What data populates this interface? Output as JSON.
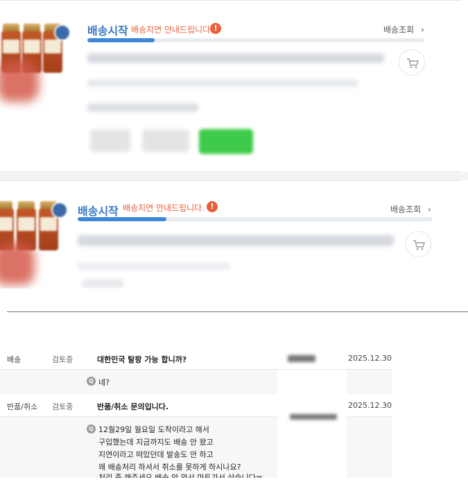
{
  "orders": [
    {
      "status": "배송시작",
      "delay_notice": "배송지연 안내드립니다.",
      "tracking_link": "배송조회",
      "progress": 0.2
    },
    {
      "status": "배송시작",
      "delay_notice": "배송지연 안내드립니다.",
      "tracking_link": "배송조회",
      "progress": 0.25
    }
  ],
  "icons": {
    "alert": "!",
    "chevron": "›",
    "question": "Q"
  },
  "colors": {
    "status_blue": "#3a78c4",
    "delay_orange": "#e8603c",
    "progress_fill": "#3f87d8",
    "buy_green": "#3ecb4a"
  },
  "inquiries": [
    {
      "category": "배송",
      "state": "검토중",
      "subject": "대한민국 탈팡 가능 합니까?",
      "date": "2025.12.30",
      "answer_lines": [
        "네?"
      ]
    },
    {
      "category": "반품/취소",
      "state": "검토중",
      "subject": "반품/취소 문의입니다.",
      "date": "2025.12.30",
      "answer_lines": [
        "12월29일 월요일 도착이라고 해서",
        "구입했는데 지금까지도 배송 안 왔고",
        "지연이라고 떠있던데 발송도 안 하고",
        "왜 배송처리 하셔서 취소를 못하게 하시나요?",
        "처리 좀 해주세요.배송 안 와서 마트가서 삿습니다ㅠ"
      ]
    }
  ]
}
